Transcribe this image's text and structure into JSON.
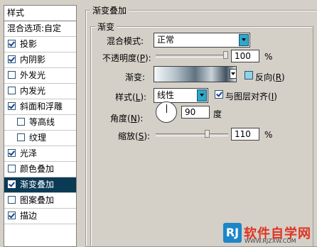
{
  "sidebar": {
    "title": "样式",
    "items": [
      {
        "label": "混合选项:自定",
        "checkbox": false,
        "checked": false,
        "sub": false,
        "selected": false
      },
      {
        "label": "投影",
        "checkbox": true,
        "checked": true,
        "sub": false,
        "selected": false
      },
      {
        "label": "内阴影",
        "checkbox": true,
        "checked": true,
        "sub": false,
        "selected": false
      },
      {
        "label": "外发光",
        "checkbox": true,
        "checked": false,
        "sub": false,
        "selected": false
      },
      {
        "label": "内发光",
        "checkbox": true,
        "checked": false,
        "sub": false,
        "selected": false
      },
      {
        "label": "斜面和浮雕",
        "checkbox": true,
        "checked": true,
        "sub": false,
        "selected": false
      },
      {
        "label": "等高线",
        "checkbox": true,
        "checked": false,
        "sub": true,
        "selected": false
      },
      {
        "label": "纹理",
        "checkbox": true,
        "checked": false,
        "sub": true,
        "selected": false
      },
      {
        "label": "光泽",
        "checkbox": true,
        "checked": true,
        "sub": false,
        "selected": false
      },
      {
        "label": "颜色叠加",
        "checkbox": true,
        "checked": false,
        "sub": false,
        "selected": false
      },
      {
        "label": "渐变叠加",
        "checkbox": true,
        "checked": true,
        "sub": false,
        "selected": true
      },
      {
        "label": "图案叠加",
        "checkbox": true,
        "checked": false,
        "sub": false,
        "selected": false
      },
      {
        "label": "描边",
        "checkbox": true,
        "checked": true,
        "sub": false,
        "selected": false
      }
    ]
  },
  "panel": {
    "group_title": "渐变叠加",
    "inner_title": "渐变",
    "blend_mode": {
      "label": "混合模式:",
      "value": "正常"
    },
    "opacity": {
      "label_pre": "不透明度(",
      "key": "P",
      "label_post": "):",
      "value": "100",
      "unit": "%",
      "level": 1.0
    },
    "gradient": {
      "label": "渐变:",
      "reverse_label_pre": "反向(",
      "reverse_key": "R",
      "reverse_label_post": ")",
      "reverse_checked": false
    },
    "style": {
      "label_pre": "样式(",
      "key": "L",
      "label_post": "):",
      "value": "线性",
      "align_label_pre": "与图层对齐(",
      "align_key": "I",
      "align_label_post": ")",
      "align_checked": true
    },
    "angle": {
      "label_pre": "角度(",
      "key": "N",
      "label_post": "):",
      "value": "90",
      "unit": "度"
    },
    "scale": {
      "label_pre": "缩放(",
      "key": "S",
      "label_post": "):",
      "value": "110",
      "unit": "%",
      "level": 0.73
    }
  },
  "watermark": {
    "logo": "RJ",
    "text": "软件自学网",
    "url": "WWW.RJZXW.COM"
  },
  "colors": {
    "selected_bg": "#0b3a55",
    "accent": "#2fa7c8",
    "checkbox_off": "#8fd3e6",
    "dialog_bg": "#d4d0c8"
  }
}
